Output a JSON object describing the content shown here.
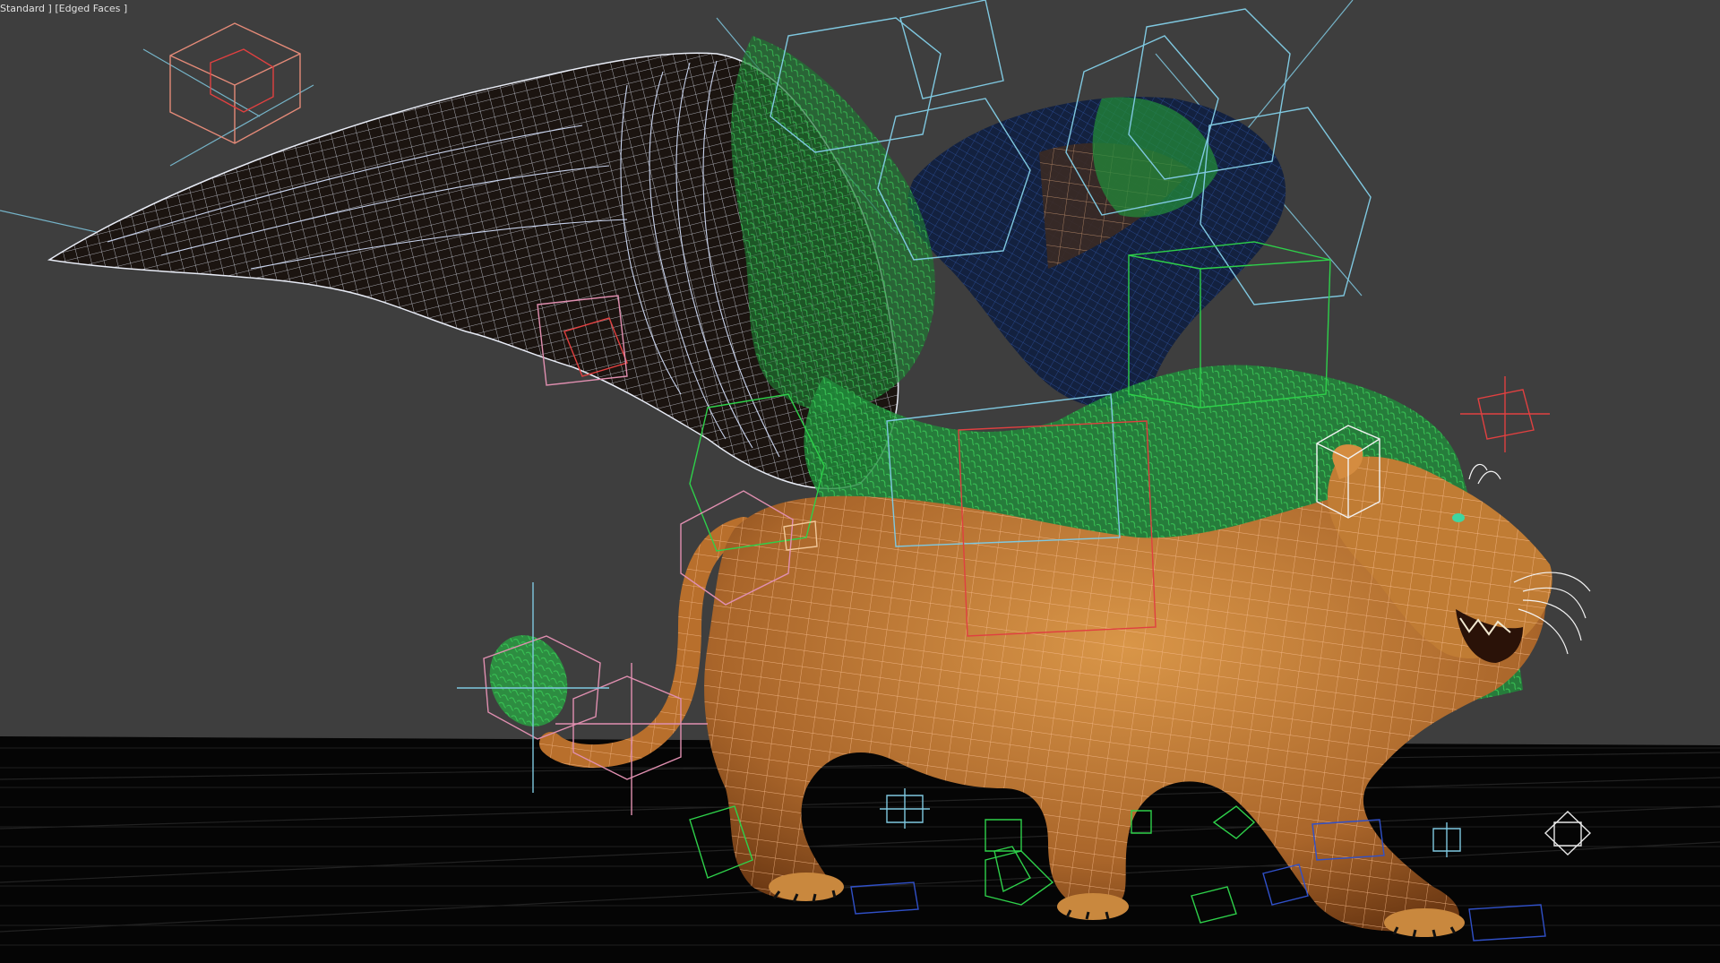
{
  "viewport": {
    "label": "Standard ] [Edged Faces ]",
    "shading_mode": "Edged Faces",
    "view_style": "Standard",
    "background_color": "#3e3e3e",
    "ground_color": "#050505"
  },
  "scene": {
    "subject": "winged lion creature with rig controls",
    "colors": {
      "body": "#c98436",
      "body_wire": "#f2b27a",
      "wing_wire": "#e8ecf6",
      "wing_fill": "#1a1512",
      "dark_wing_blue": "#1d3a7a",
      "hair_green": "#2fa84a",
      "control_cyan": "#7fc8e0",
      "control_pink": "#e08fb0",
      "control_red": "#e04040",
      "control_green": "#2ed04a",
      "control_blue": "#3050c8"
    }
  }
}
